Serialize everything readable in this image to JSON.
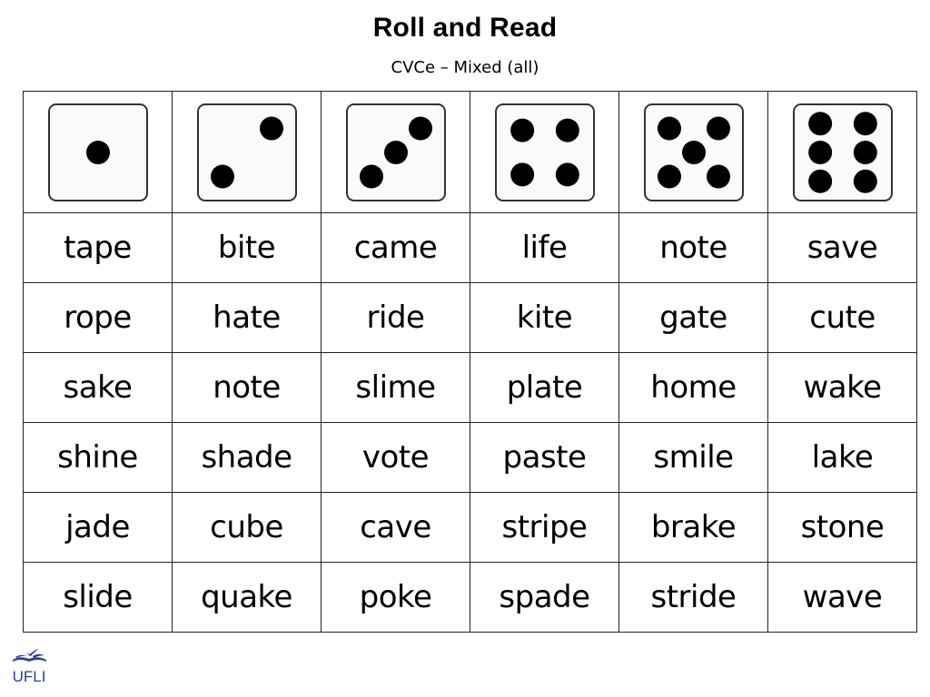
{
  "header": {
    "title": "Roll and Read",
    "subtitle": "CVCe – Mixed (all)"
  },
  "dice": [
    1,
    2,
    3,
    4,
    5,
    6
  ],
  "words": [
    [
      "tape",
      "bite",
      "came",
      "life",
      "note",
      "save"
    ],
    [
      "rope",
      "hate",
      "ride",
      "kite",
      "gate",
      "cute"
    ],
    [
      "sake",
      "note",
      "slime",
      "plate",
      "home",
      "wake"
    ],
    [
      "shine",
      "shade",
      "vote",
      "paste",
      "smile",
      "lake"
    ],
    [
      "jade",
      "cube",
      "cave",
      "stripe",
      "brake",
      "stone"
    ],
    [
      "slide",
      "quake",
      "poke",
      "spade",
      "stride",
      "wave"
    ]
  ],
  "logo": {
    "icon": "open-book-bird-icon",
    "text": "UFLI",
    "color": "#2a3f8f"
  }
}
